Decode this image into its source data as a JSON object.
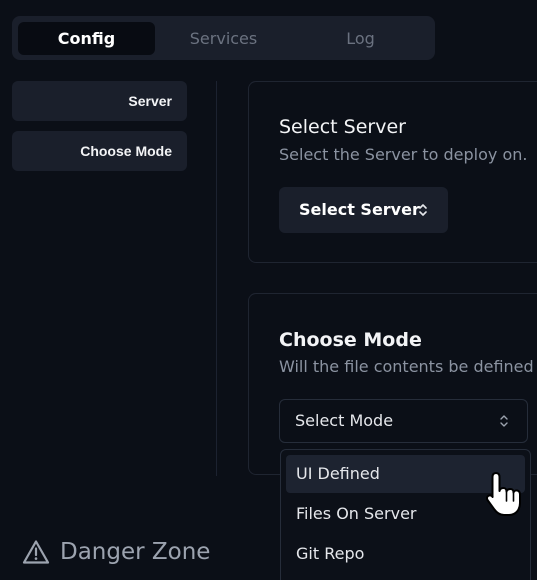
{
  "tabs": {
    "config": "Config",
    "services": "Services",
    "log": "Log",
    "active": "Config"
  },
  "nav": {
    "server": "Server",
    "choose_mode": "Choose Mode"
  },
  "server_card": {
    "title": "Select Server",
    "description": "Select the Server to deploy on.",
    "button_label": "Select Server",
    "button_icon": "chevron-up-down-icon"
  },
  "mode_card": {
    "title": "Choose Mode",
    "description": "Will the file contents be defined in",
    "select_value": "Select Mode",
    "select_icon": "chevron-up-down-icon"
  },
  "dropdown": {
    "options": [
      "UI Defined",
      "Files On Server",
      "Git Repo"
    ],
    "hovered": "UI Defined"
  },
  "danger_zone": {
    "label": "Danger Zone",
    "icon": "warning-triangle-icon"
  },
  "colors": {
    "background": "#0b0f17",
    "panel": "#1a1f2b",
    "text_primary": "#f3f4f6",
    "text_muted": "#8b93a1"
  }
}
